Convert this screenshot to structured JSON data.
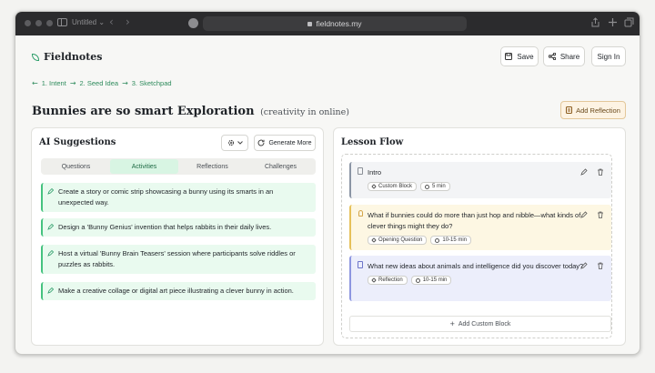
{
  "browser": {
    "tab_title": "Untitled",
    "url": "fieldnotes.my"
  },
  "header": {
    "brand": "Fieldnotes",
    "save_label": "Save",
    "share_label": "Share",
    "signin_label": "Sign In"
  },
  "breadcrumb": [
    "1. Intent",
    "2. Seed Idea",
    "3. Sketchpad"
  ],
  "page": {
    "title": "Bunnies are so smart Exploration",
    "subtitle": "(creativity in online)",
    "add_reflection": "Add Reflection"
  },
  "suggestions": {
    "title": "AI Suggestions",
    "generate_label": "Generate More",
    "tabs": [
      "Questions",
      "Activities",
      "Reflections",
      "Challenges"
    ],
    "active_tab": "Activities",
    "items": [
      "Create a story or comic strip showcasing a bunny using its smarts in an unexpected way.",
      "Design a 'Bunny Genius' invention that helps rabbits in their daily lives.",
      "Host a virtual 'Bunny Brain Teasers' session where participants solve riddles or puzzles as rabbits.",
      "Make a creative collage or digital art piece illustrating a clever bunny in action."
    ]
  },
  "lesson_flow": {
    "title": "Lesson Flow",
    "add_block_label": "Add Custom Block",
    "blocks": [
      {
        "text": "Intro",
        "tag": "Custom Block",
        "duration": "5 min",
        "color": "#f3f4f6",
        "border": "#8b95a5"
      },
      {
        "text": "What if bunnies could do more than just hop and nibble—what kinds of clever things might they do?",
        "tag": "Opening Question",
        "duration": "10-15 min",
        "color": "#fdf7e3",
        "border": "#e6c15a"
      },
      {
        "text": "What new ideas about animals and intelligence did you discover today?",
        "tag": "Reflection",
        "duration": "10-15 min",
        "color": "#eceefb",
        "border": "#8d96e0"
      }
    ]
  },
  "colors": {
    "accent": "#2e9e6a",
    "suggestion_bg": "#e9faef",
    "reflection_btn_bg": "#fdf3e3"
  }
}
